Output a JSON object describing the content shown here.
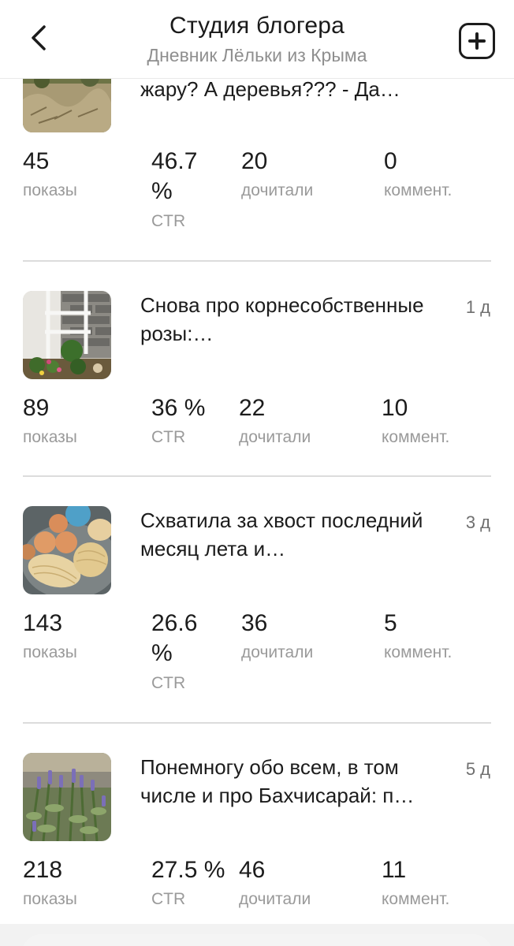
{
  "header": {
    "title": "Студия блогера",
    "subtitle": "Дневник Лёльки из Крыма"
  },
  "posts": [
    {
      "title": "жару? А деревья??? - Да…",
      "age": "",
      "image": "garden-mulch-photo",
      "views": "45",
      "views_label": "показы",
      "ctr": "46.7 %",
      "ctr_label": "CTR",
      "reads": "20",
      "reads_label": "дочитали",
      "comments": "0",
      "comments_label": "коммент."
    },
    {
      "title": "Снова про корнесобственные розы:…",
      "age": "1 д",
      "image": "rose-trellis-photo",
      "views": "89",
      "views_label": "показы",
      "ctr": "36 %",
      "ctr_label": "CTR",
      "reads": "22",
      "reads_label": "дочитали",
      "comments": "10",
      "comments_label": "коммент."
    },
    {
      "title": "Схватила за хвост последний месяц лета и…",
      "age": "3 д",
      "image": "melons-photo",
      "views": "143",
      "views_label": "показы",
      "ctr": "26.6 %",
      "ctr_label": "CTR",
      "reads": "36",
      "reads_label": "дочитали",
      "comments": "5",
      "comments_label": "коммент."
    },
    {
      "title": "Понемногу обо всем, в том числе и про Бахчисарай: п…",
      "age": "5 д",
      "image": "lavender-photo",
      "views": "218",
      "views_label": "показы",
      "ctr": "27.5 %",
      "ctr_label": "CTR",
      "reads": "46",
      "reads_label": "дочитали",
      "comments": "11",
      "comments_label": "коммент."
    }
  ],
  "icons": {
    "back": "back-arrow-icon",
    "add": "add-post-icon"
  }
}
